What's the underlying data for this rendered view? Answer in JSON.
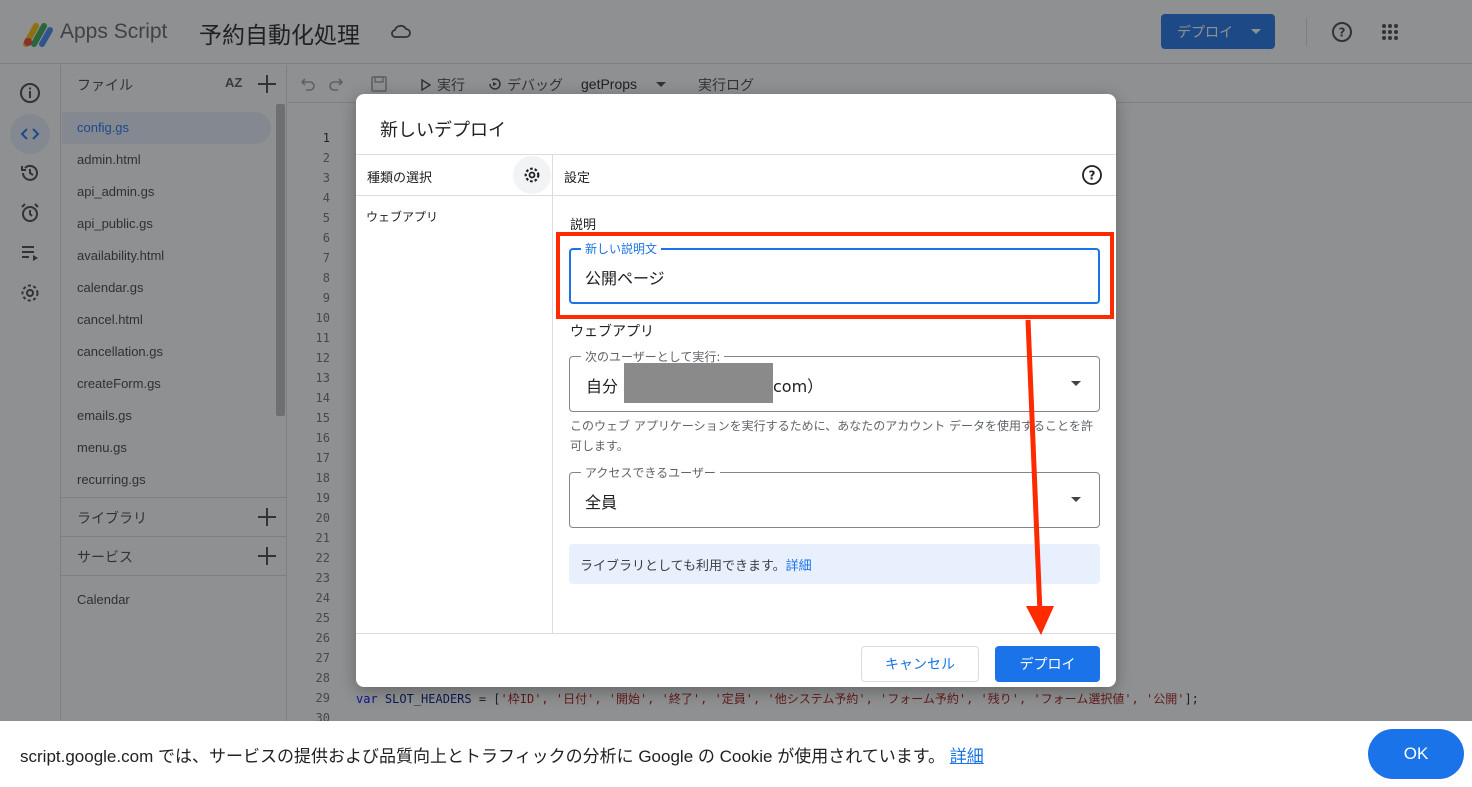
{
  "app": {
    "brand": "Apps Script",
    "project_title": "予約自動化処理",
    "deploy_button": "デプロイ"
  },
  "files": {
    "header": "ファイル",
    "sort_label": "AZ",
    "items": [
      "config.gs",
      "admin.html",
      "api_admin.gs",
      "api_public.gs",
      "availability.html",
      "calendar.gs",
      "cancel.html",
      "cancellation.gs",
      "createForm.gs",
      "emails.gs",
      "menu.gs",
      "recurring.gs"
    ],
    "libraries": "ライブラリ",
    "services": "サービス",
    "service_items": [
      "Calendar"
    ]
  },
  "toolbar": {
    "run": "実行",
    "debug": "デバッグ",
    "function": "getProps",
    "log": "実行ログ"
  },
  "editor": {
    "line_numbers": [
      "1",
      "2",
      "3",
      "4",
      "5",
      "6",
      "7",
      "8",
      "9",
      "10",
      "11",
      "12",
      "13",
      "14",
      "15",
      "16",
      "17",
      "18",
      "19",
      "20",
      "21",
      "22",
      "23",
      "24",
      "25",
      "26",
      "27",
      "28",
      "29",
      "30"
    ],
    "code_line29": {
      "kw": "var",
      "id": "SLOT_HEADERS",
      "eq": " = [",
      "strings": "'枠ID', '日付', '開始', '終了', '定員', '他システム予約', 'フォーム予約', '残り', 'フォーム選択値', '公開'",
      "end": "];"
    }
  },
  "dialog": {
    "title": "新しいデプロイ",
    "type_header": "種類の選択",
    "type_item": "ウェブアプリ",
    "settings_header": "設定",
    "description_label": "説明",
    "description_field_label": "新しい説明文",
    "description_value": "公開ページ",
    "webapp_label": "ウェブアプリ",
    "execute_as_label": "次のユーザーとして実行:",
    "execute_as_prefix": "自分",
    "execute_as_suffix": "com）",
    "execute_note": "このウェブ アプリケーションを実行するために、あなたのアカウント データを使用することを許可します。",
    "access_label": "アクセスできるユーザー",
    "access_value": "全員",
    "info_text": "ライブラリとしても利用できます。",
    "info_link": "詳細",
    "cancel": "キャンセル",
    "deploy": "デプロイ"
  },
  "cookie": {
    "text": "script.google.com では、サービスの提供および品質向上とトラフィックの分析に Google の Cookie が使用されています。",
    "link": "詳細",
    "ok": "OK"
  },
  "colors": {
    "accent": "#1a73e8",
    "highlight": "#ff2a00"
  }
}
